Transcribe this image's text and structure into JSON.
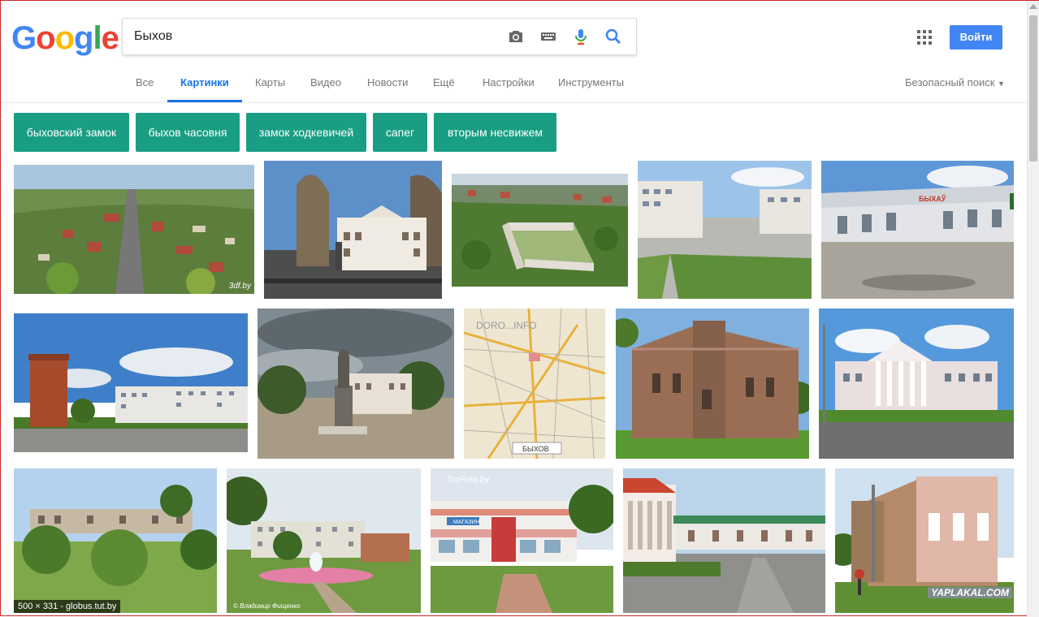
{
  "logo": {
    "letters": [
      "G",
      "o",
      "o",
      "g",
      "l",
      "e"
    ],
    "colors": [
      "#4285f4",
      "#ea4335",
      "#fbbc05",
      "#4285f4",
      "#34a853",
      "#ea4335"
    ]
  },
  "search": {
    "value": "Быхов",
    "placeholder": ""
  },
  "icons": {
    "camera": "camera-icon",
    "keyboard": "keyboard-icon",
    "mic": "mic-icon",
    "search": "search-icon",
    "apps": "apps-grid-icon"
  },
  "signin": "Войти",
  "tabs": [
    "Все",
    "Картинки",
    "Карты",
    "Видео",
    "Новости",
    "Ещё",
    "Настройки",
    "Инструменты"
  ],
  "active_tab": "Картинки",
  "safe_search": "Безопасный поиск",
  "chips": [
    "быховский замок",
    "быхов часовня",
    "замок ходкевичей",
    "сапег",
    "вторым несвижем"
  ],
  "thumbs": [
    {
      "alt": "aerial view of Bykhov",
      "watermark": "3df.by"
    },
    {
      "alt": "town hall building",
      "watermark": ""
    },
    {
      "alt": "castle ruins aerial",
      "watermark": ""
    },
    {
      "alt": "street with apartment blocks",
      "watermark": ""
    },
    {
      "alt": "bus station Быхаў",
      "sign": "БЫХАЎ",
      "watermark": ""
    },
    {
      "alt": "red water tower",
      "watermark": ""
    },
    {
      "alt": "Lenin monument",
      "watermark": ""
    },
    {
      "alt": "city map",
      "map_text": "БЫХОВ",
      "watermark": ""
    },
    {
      "alt": "old synagogue ruins",
      "watermark": ""
    },
    {
      "alt": "white columned building",
      "watermark": ""
    },
    {
      "alt": "castle ruins behind trees",
      "caption": "500 × 331 - globus.tut.by"
    },
    {
      "alt": "fountain square",
      "watermark": "© Владимир Фищенко"
    },
    {
      "alt": "shop building",
      "sign": "МАГАЗИН",
      "watermark": "TurFoto.by"
    },
    {
      "alt": "street view",
      "watermark": ""
    },
    {
      "alt": "synagogue ruins",
      "watermark": "YAPLAKAL.COM"
    }
  ],
  "colors": {
    "accent": "#1a73e8",
    "chip": "#199e84",
    "signin": "#4285f4"
  }
}
